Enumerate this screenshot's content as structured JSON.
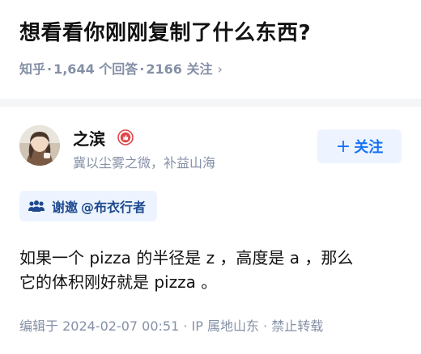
{
  "question": {
    "title": "想看看你刚刚复制了什么东西?",
    "source": "知乎",
    "answers": "1,644 个回答",
    "followers": "2166 关注",
    "dot1": "·",
    "dot2": "·",
    "chevron": "›"
  },
  "author": {
    "name": "之滨",
    "bio": "冀以尘雾之微，补益山海",
    "avatar_icon": "avatar-photo",
    "badge_icon": "thumb-badge-icon"
  },
  "follow_button": {
    "plus": "+",
    "label": "关注"
  },
  "invite": {
    "icon": "group-icon",
    "prefix": "谢邀",
    "mention": "@布衣行者"
  },
  "answer": {
    "lines": [
      "如果一个 pizza 的半径是 z ，高度是 a ，那么",
      "它的体积刚好就是 pizza 。"
    ],
    "footer": "编辑于 2024-02-07 00:51 · IP 属地山东 · 禁止转载"
  },
  "colors": {
    "accent": "#1772f6",
    "accent_bg": "#edf4ff",
    "meta_gray": "#8590a6",
    "badge_red": "#e0454b"
  }
}
